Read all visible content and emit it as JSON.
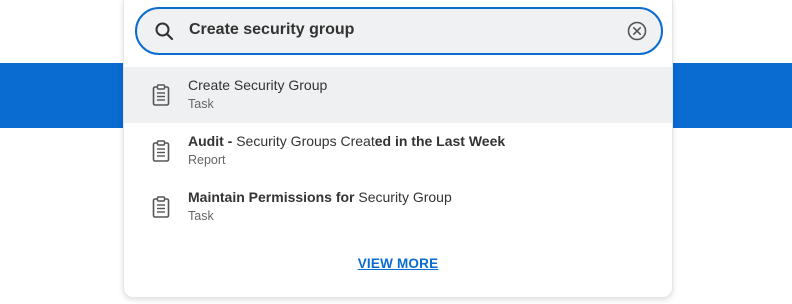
{
  "search": {
    "value": "Create security group"
  },
  "results": [
    {
      "title_parts": [
        {
          "text": "Create Security Group",
          "bold": false
        }
      ],
      "type": "Task",
      "icon": "clipboard-icon",
      "highlighted": true
    },
    {
      "title_parts": [
        {
          "text": "Audit - ",
          "bold": true
        },
        {
          "text": "Security Groups Creat",
          "bold": false
        },
        {
          "text": "ed in the Last Week",
          "bold": true
        }
      ],
      "type": "Report",
      "icon": "clipboard-icon",
      "highlighted": false
    },
    {
      "title_parts": [
        {
          "text": "Maintain Permissions for ",
          "bold": true
        },
        {
          "text": "Security Group",
          "bold": false
        }
      ],
      "type": "Task",
      "icon": "clipboard-icon",
      "highlighted": false
    }
  ],
  "view_more_label": "VIEW MORE",
  "colors": {
    "accent": "#0a6bd0",
    "highlight": "#eef0f2",
    "text": "#333333",
    "subtext": "#666666"
  }
}
